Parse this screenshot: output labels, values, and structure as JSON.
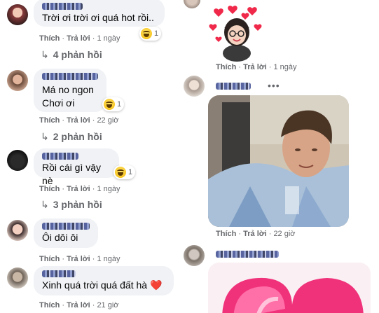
{
  "left_comments": [
    {
      "text": "Trời ơi trời ơi quá hot rồi..",
      "reaction_count": "1",
      "actions": {
        "like": "Thích",
        "reply": "Trả lời",
        "time": "1 ngày"
      },
      "replies": "4 phản hồi"
    },
    {
      "text": "Má no ngon\nChơi ơi",
      "reaction_count": "1",
      "actions": {
        "like": "Thích",
        "reply": "Trả lời",
        "time": "22 giờ"
      },
      "replies": "2 phản hồi"
    },
    {
      "text": "Rồi cái gì vậy nè",
      "reaction_count": "1",
      "actions": {
        "like": "Thích",
        "reply": "Trả lời",
        "time": "1 ngày"
      },
      "replies": "3 phản hồi"
    },
    {
      "text": "Ôi dôi ôi",
      "actions": {
        "like": "Thích",
        "reply": "Trả lời",
        "time": "1 ngày"
      }
    },
    {
      "text": "Xinh quá trời quá đất hà ❤️",
      "actions": {
        "like": "Thích",
        "reply": "Trả lời",
        "time": "21 giờ"
      }
    }
  ],
  "right_comments": [
    {
      "actions": {
        "like": "Thích",
        "reply": "Trả lời",
        "time": "1 ngày"
      }
    },
    {
      "actions": {
        "like": "Thích",
        "reply": "Trả lời",
        "time": "22 giờ"
      },
      "more": "•••"
    }
  ],
  "separator": "·",
  "colors": {
    "bubble": "#f0f2f5",
    "meta": "#65676b",
    "heart": "#f02849"
  }
}
